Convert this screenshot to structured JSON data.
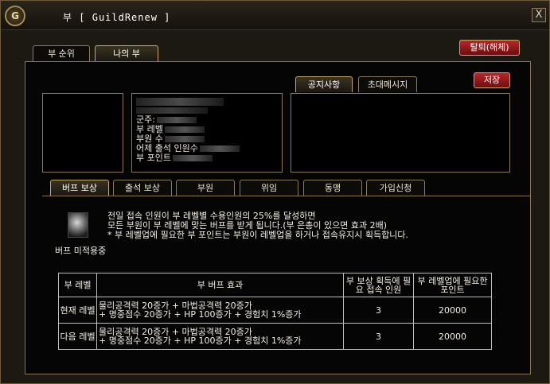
{
  "window": {
    "logo": "G",
    "title": "부 [ GuildRenew ]",
    "close": "X"
  },
  "top_tabs": [
    "부 순위",
    "나의 부"
  ],
  "withdraw_button": "탈퇴(해체)",
  "save_button": "저장",
  "notice_tabs": [
    "공지사항",
    "초대메시지"
  ],
  "guild_info": {
    "lines": [
      "군주:",
      "부 레벨",
      "부원 수",
      "어제 출석 인원수",
      "부 포인트"
    ]
  },
  "section_tabs": [
    "버프 보상",
    "출석 보상",
    "부원",
    "위임",
    "동맹",
    "가입신청"
  ],
  "buff": {
    "description": [
      "전일 접속 인원이 부 레벨별 수용인원의 25%를 달성하면",
      "모든 부원이 부 레벨에 맞는 버프를 받게 됩니다.(부 은총이 있으면 효과 2배)",
      "* 부 레벨업에 필요한 부 포인트는 부원이 레벨업을 하거나 접속유지시 획득합니다."
    ],
    "status": "버프 미적용중",
    "table": {
      "headers": [
        "부 레벨",
        "부 버프 효과",
        "부 보상 획득에 필요 접속 인원",
        "부 레벨업에 필요한 포인트"
      ],
      "rows": [
        {
          "level": "현재 레벨",
          "effect_line1": "물리공격력 20증가 + 마법공격력 20증가",
          "effect_line2": "+ 명중점수 20증가 + HP 100증가 + 경험치 1%증가",
          "required_users": "3",
          "required_points": "20000"
        },
        {
          "level": "다음 레벨",
          "effect_line1": "물리공격력 20증가 + 마법공격력 20증가",
          "effect_line2": "+ 명중점수 20증가 + HP 100증가 + 경험치 1%증가",
          "required_users": "3",
          "required_points": "20000"
        }
      ]
    }
  }
}
